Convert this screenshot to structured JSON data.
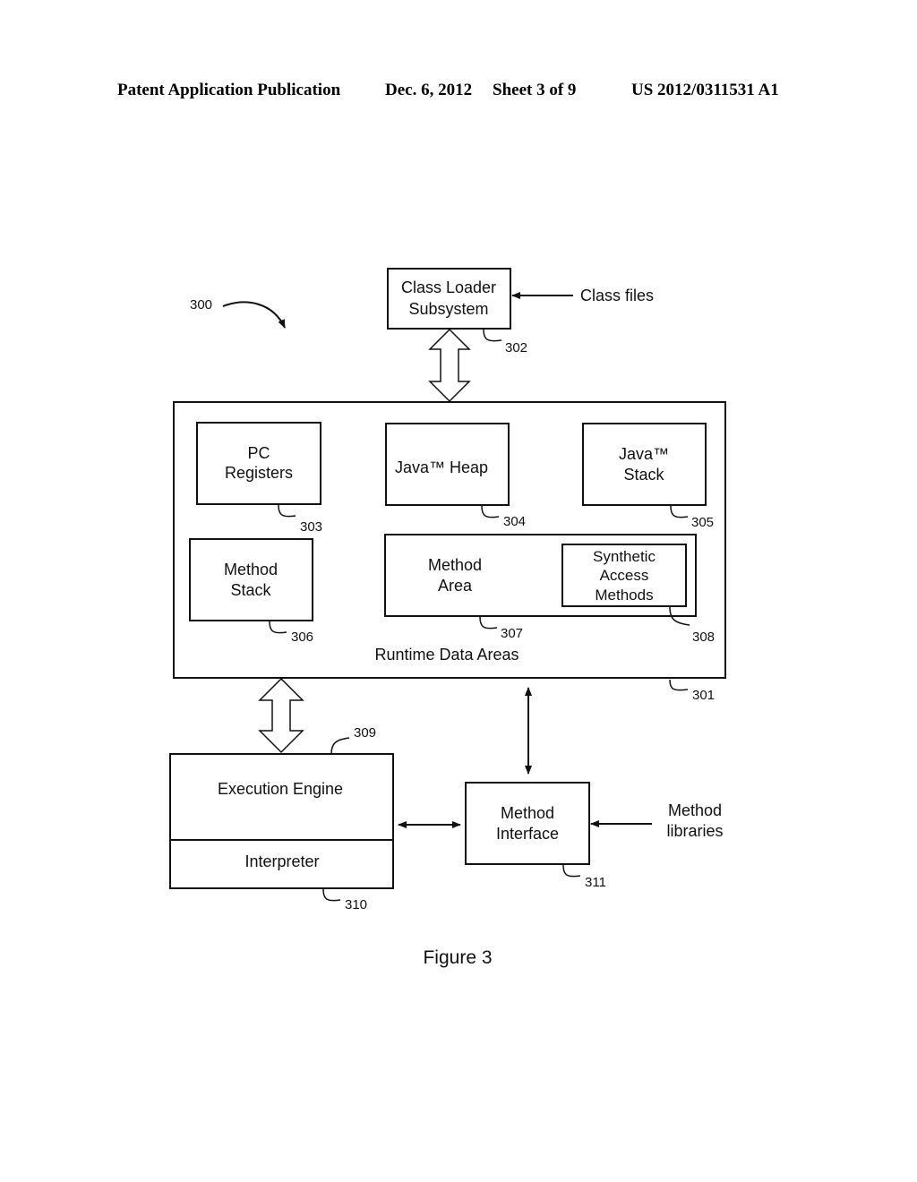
{
  "header": {
    "publication": "Patent Application Publication",
    "date": "Dec. 6, 2012",
    "sheet": "Sheet 3 of 9",
    "number": "US 2012/0311531 A1"
  },
  "figure": {
    "ref": "300",
    "caption": "Figure 3"
  },
  "nodes": {
    "class_loader": {
      "lines": [
        "Class Loader",
        "Subsystem"
      ],
      "ref": "302"
    },
    "class_files": {
      "label": "Class files"
    },
    "runtime_data_areas": {
      "label": "Runtime Data Areas",
      "ref": "301"
    },
    "pc_registers": {
      "lines": [
        "PC",
        "Registers"
      ],
      "ref": "303"
    },
    "java_heap": {
      "label": "Java™  Heap",
      "ref": "304"
    },
    "java_stack": {
      "lines": [
        "Java™",
        "Stack"
      ],
      "ref": "305"
    },
    "method_stack": {
      "lines": [
        "Method",
        "Stack"
      ],
      "ref": "306"
    },
    "method_area": {
      "lines": [
        "Method",
        "Area"
      ],
      "ref": "307"
    },
    "synthetic_access": {
      "lines": [
        "Synthetic",
        "Access",
        "Methods"
      ],
      "ref": "308"
    },
    "execution_engine": {
      "label": "Execution Engine",
      "ref": "309"
    },
    "interpreter": {
      "label": "Interpreter",
      "ref": "310"
    },
    "method_interface": {
      "lines": [
        "Method",
        "Interface"
      ],
      "ref": "311"
    },
    "method_libraries": {
      "lines": [
        "Method",
        "libraries"
      ]
    }
  }
}
